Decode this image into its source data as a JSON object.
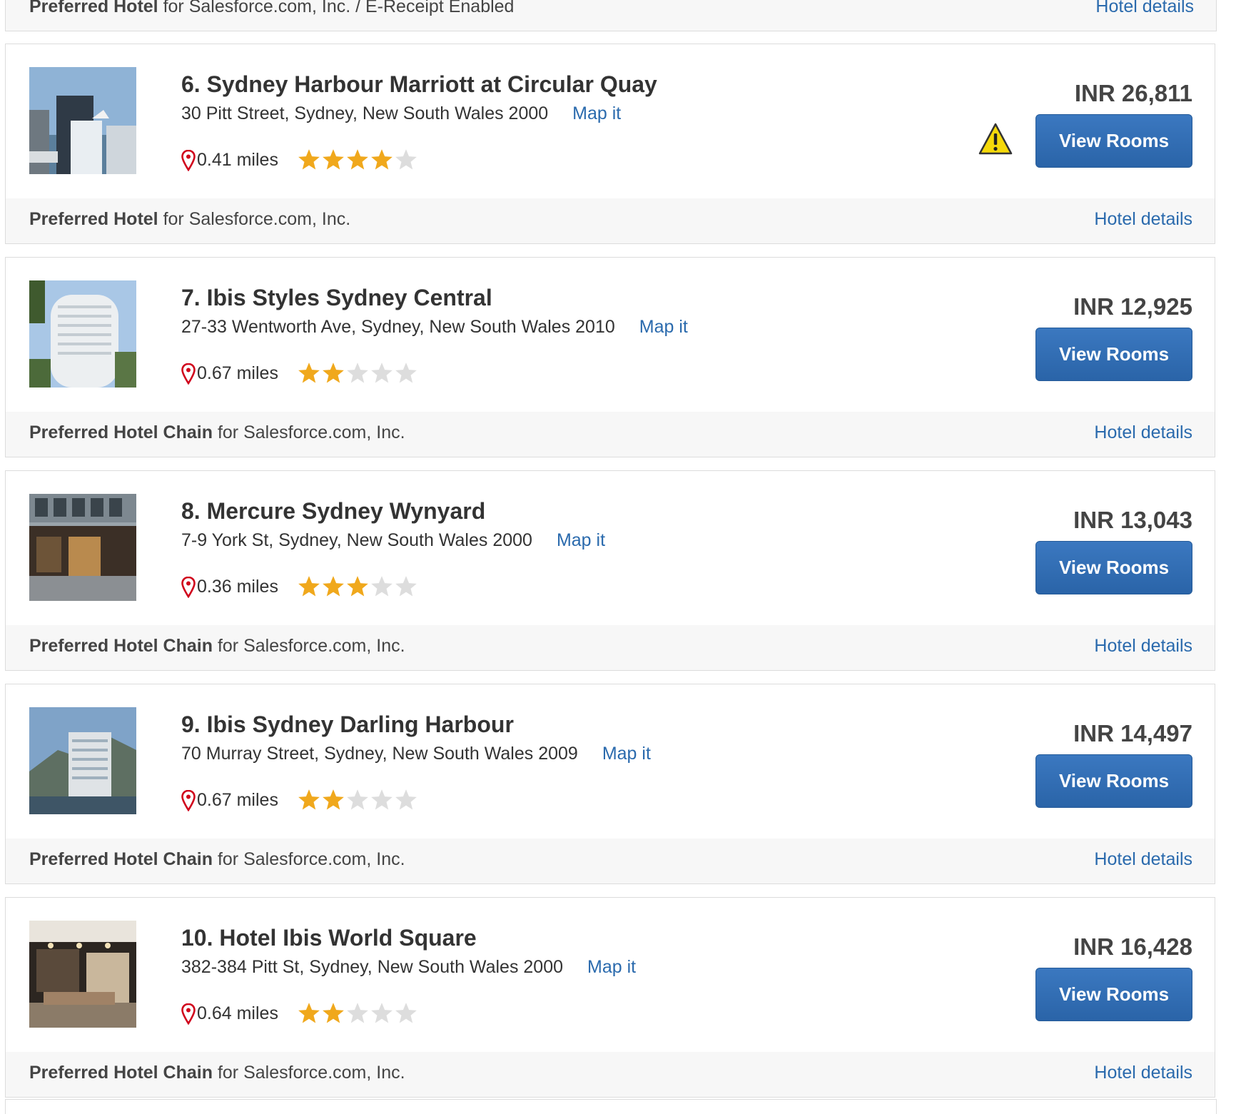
{
  "top_footer": {
    "pref_bold": "Preferred Hotel",
    "pref_text": " for Salesforce.com, Inc. / E-Receipt Enabled",
    "details_label": "Hotel details"
  },
  "hotels": [
    {
      "name": "6. Sydney Harbour Marriott at Circular Quay",
      "address": "30 Pitt Street, Sydney, New South Wales 2000",
      "map_label": "Map it",
      "distance": "0.41 miles",
      "stars": 4,
      "price": "INR 26,811",
      "button_label": "View Rooms",
      "warning": true,
      "pref_bold": "Preferred Hotel",
      "pref_text": " for Salesforce.com, Inc.",
      "details_label": "Hotel details"
    },
    {
      "name": "7. Ibis Styles Sydney Central",
      "address": "27-33 Wentworth Ave, Sydney, New South Wales 2010",
      "map_label": "Map it",
      "distance": "0.67 miles",
      "stars": 2,
      "price": "INR 12,925",
      "button_label": "View Rooms",
      "warning": false,
      "pref_bold": "Preferred Hotel Chain",
      "pref_text": " for Salesforce.com, Inc.",
      "details_label": "Hotel details"
    },
    {
      "name": "8. Mercure Sydney Wynyard",
      "address": "7-9 York St, Sydney, New South Wales 2000",
      "map_label": "Map it",
      "distance": "0.36 miles",
      "stars": 3,
      "price": "INR 13,043",
      "button_label": "View Rooms",
      "warning": false,
      "pref_bold": "Preferred Hotel Chain",
      "pref_text": " for Salesforce.com, Inc.",
      "details_label": "Hotel details"
    },
    {
      "name": "9. Ibis Sydney Darling Harbour",
      "address": "70 Murray Street, Sydney, New South Wales 2009",
      "map_label": "Map it",
      "distance": "0.67 miles",
      "stars": 2,
      "price": "INR 14,497",
      "button_label": "View Rooms",
      "warning": false,
      "pref_bold": "Preferred Hotel Chain",
      "pref_text": " for Salesforce.com, Inc.",
      "details_label": "Hotel details"
    },
    {
      "name": "10. Hotel Ibis World Square",
      "address": "382-384 Pitt St, Sydney, New South Wales 2000",
      "map_label": "Map it",
      "distance": "0.64 miles",
      "stars": 2,
      "price": "INR 16,428",
      "button_label": "View Rooms",
      "warning": false,
      "pref_bold": "Preferred Hotel Chain",
      "pref_text": " for Salesforce.com, Inc.",
      "details_label": "Hotel details"
    }
  ],
  "colors": {
    "link": "#2a6aad",
    "button": "#2f6db3",
    "star_on": "#f0a81c",
    "star_off": "#dddddd",
    "pin": "#d0021b",
    "warning": "#f5d90a"
  },
  "icons": {
    "pin": "map-pin-icon",
    "star": "star-icon",
    "warning": "warning-icon"
  }
}
